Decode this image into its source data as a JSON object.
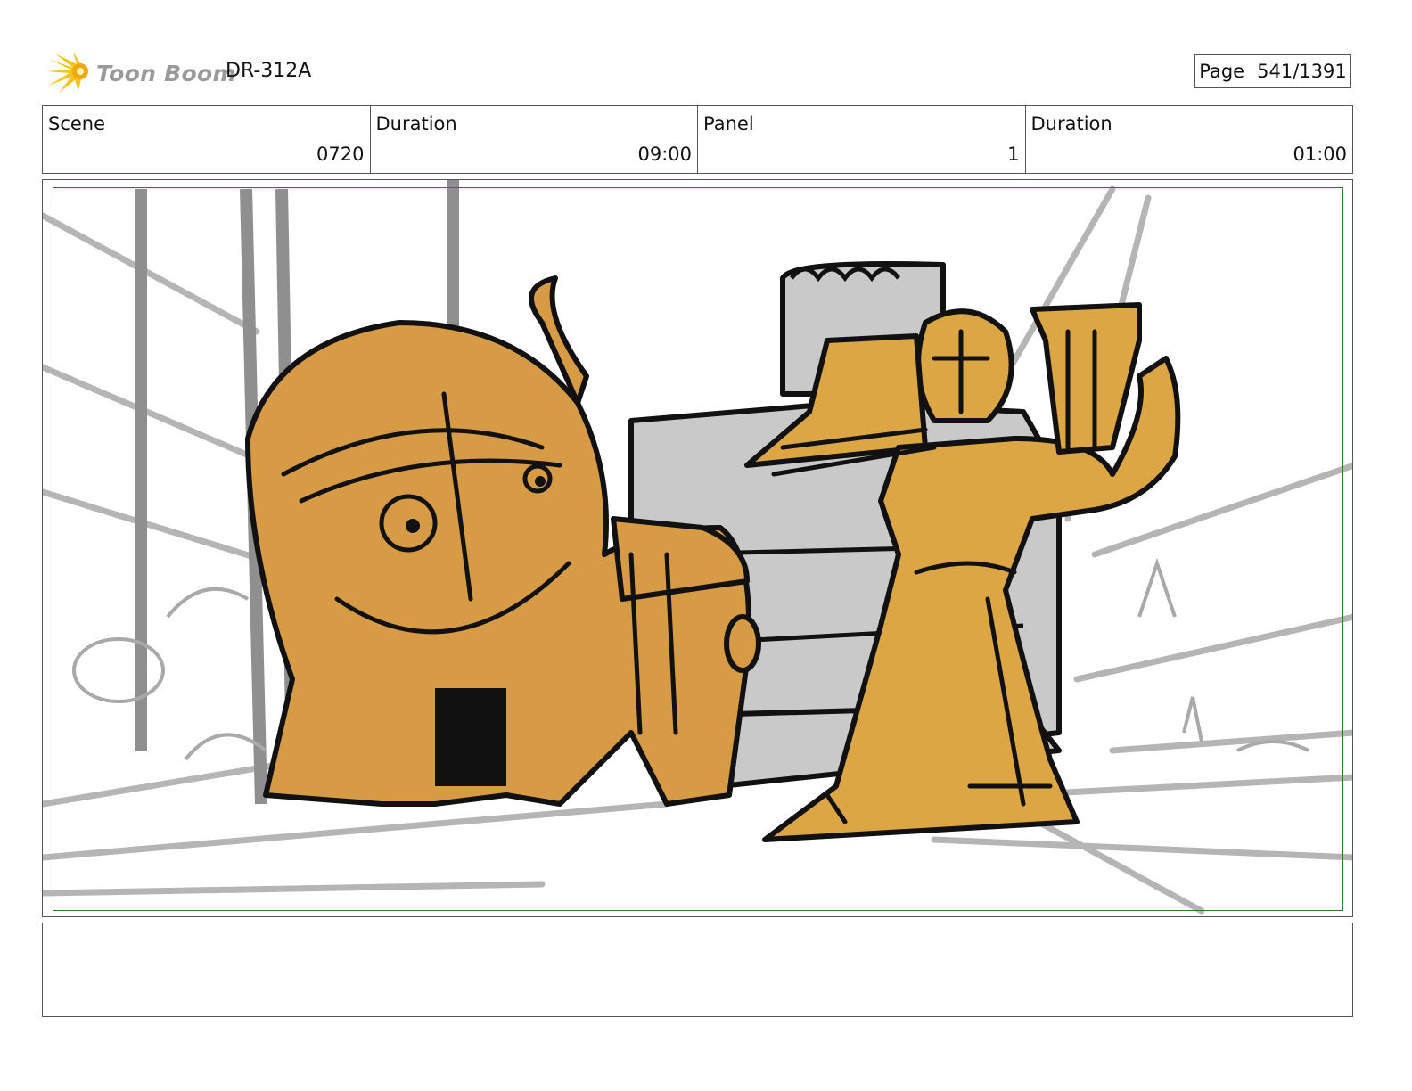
{
  "header": {
    "logo_text": "Toon Boom",
    "project_code": "DR-312A",
    "page_label": "Page",
    "page_value": "541/1391"
  },
  "info": {
    "scene_label": "Scene",
    "scene_value": "0720",
    "scene_duration_label": "Duration",
    "scene_duration_value": "09:00",
    "panel_label": "Panel",
    "panel_value": "1",
    "panel_duration_label": "Duration",
    "panel_duration_value": "01:00"
  },
  "colors": {
    "safe_area_border": "#2f7a32",
    "creature_fill": "#d79a45",
    "figure_fill": "#dba643",
    "machine_fill": "#c9c9c9",
    "background_lines": "#b5b5b5"
  },
  "notes": ""
}
